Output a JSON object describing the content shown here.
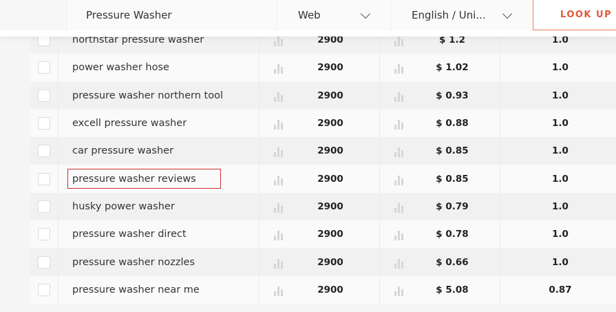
{
  "search": {
    "query": "Pressure Washer",
    "engine": "Web",
    "language": "English / Uni...",
    "lookup_label": "LOOK UP"
  },
  "rows": [
    {
      "keyword": "northstar pressure washer",
      "volume": "2900",
      "cpc": "$ 1.2",
      "competition": "1.0"
    },
    {
      "keyword": "power washer hose",
      "volume": "2900",
      "cpc": "$ 1.02",
      "competition": "1.0"
    },
    {
      "keyword": "pressure washer northern tool",
      "volume": "2900",
      "cpc": "$ 0.93",
      "competition": "1.0"
    },
    {
      "keyword": "excell pressure washer",
      "volume": "2900",
      "cpc": "$ 0.88",
      "competition": "1.0"
    },
    {
      "keyword": "car pressure washer",
      "volume": "2900",
      "cpc": "$ 0.85",
      "competition": "1.0"
    },
    {
      "keyword": "pressure washer reviews",
      "volume": "2900",
      "cpc": "$ 0.85",
      "competition": "1.0"
    },
    {
      "keyword": "husky power washer",
      "volume": "2900",
      "cpc": "$ 0.79",
      "competition": "1.0"
    },
    {
      "keyword": "pressure washer direct",
      "volume": "2900",
      "cpc": "$ 0.78",
      "competition": "1.0"
    },
    {
      "keyword": "pressure washer nozzles",
      "volume": "2900",
      "cpc": "$ 0.66",
      "competition": "1.0"
    },
    {
      "keyword": "pressure washer near me",
      "volume": "2900",
      "cpc": "$ 5.08",
      "competition": "0.87"
    }
  ],
  "highlighted_row": 5,
  "colors": {
    "accent": "#e05a3a",
    "highlight_border": "#c9302c"
  }
}
